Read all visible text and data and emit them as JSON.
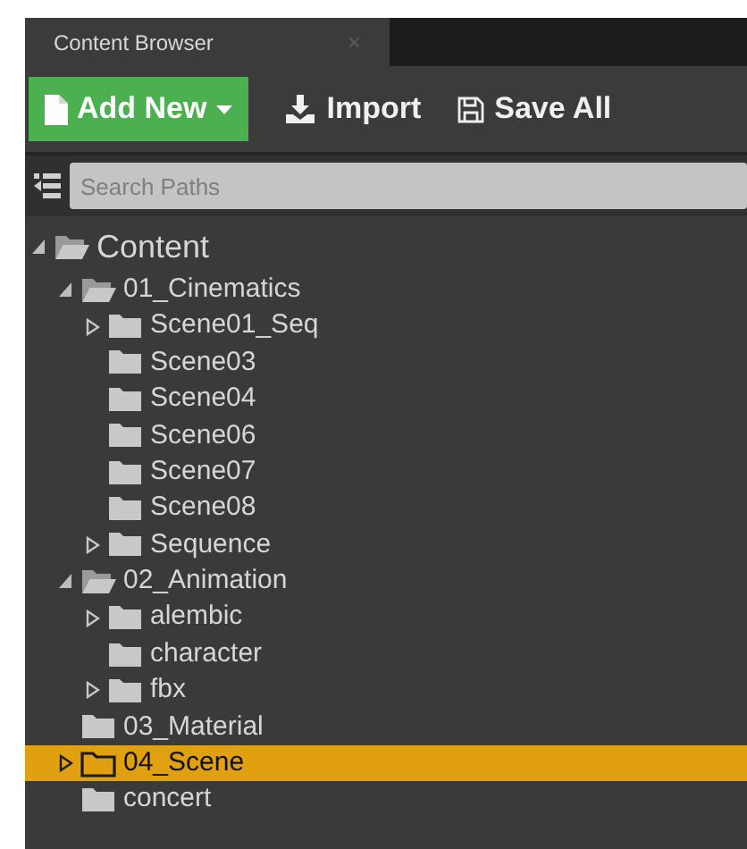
{
  "tab": {
    "title": "Content Browser",
    "close": "×",
    "selected": true
  },
  "toolbar": {
    "add_new": "Add New",
    "import": "Import",
    "save_all": "Save All"
  },
  "search": {
    "placeholder": "Search Paths"
  },
  "tree": [
    {
      "label": "Content",
      "expanded": true,
      "has_children": true,
      "selected": false,
      "children": [
        {
          "label": "01_Cinematics",
          "expanded": true,
          "has_children": true,
          "selected": false,
          "children": [
            {
              "label": "Scene01_Seq",
              "expanded": false,
              "has_children": true,
              "selected": false
            },
            {
              "label": "Scene03",
              "expanded": false,
              "has_children": false,
              "selected": false
            },
            {
              "label": "Scene04",
              "expanded": false,
              "has_children": false,
              "selected": false
            },
            {
              "label": "Scene06",
              "expanded": false,
              "has_children": false,
              "selected": false
            },
            {
              "label": "Scene07",
              "expanded": false,
              "has_children": false,
              "selected": false
            },
            {
              "label": "Scene08",
              "expanded": false,
              "has_children": false,
              "selected": false
            },
            {
              "label": "Sequence",
              "expanded": false,
              "has_children": true,
              "selected": false
            }
          ]
        },
        {
          "label": "02_Animation",
          "expanded": true,
          "has_children": true,
          "selected": false,
          "children": [
            {
              "label": "alembic",
              "expanded": false,
              "has_children": true,
              "selected": false
            },
            {
              "label": "character",
              "expanded": false,
              "has_children": false,
              "selected": false
            },
            {
              "label": "fbx",
              "expanded": false,
              "has_children": true,
              "selected": false
            }
          ]
        },
        {
          "label": "03_Material",
          "expanded": false,
          "has_children": false,
          "selected": false
        },
        {
          "label": "04_Scene",
          "expanded": false,
          "has_children": true,
          "selected": true
        },
        {
          "label": "concert",
          "expanded": false,
          "has_children": false,
          "selected": false
        }
      ]
    }
  ]
}
